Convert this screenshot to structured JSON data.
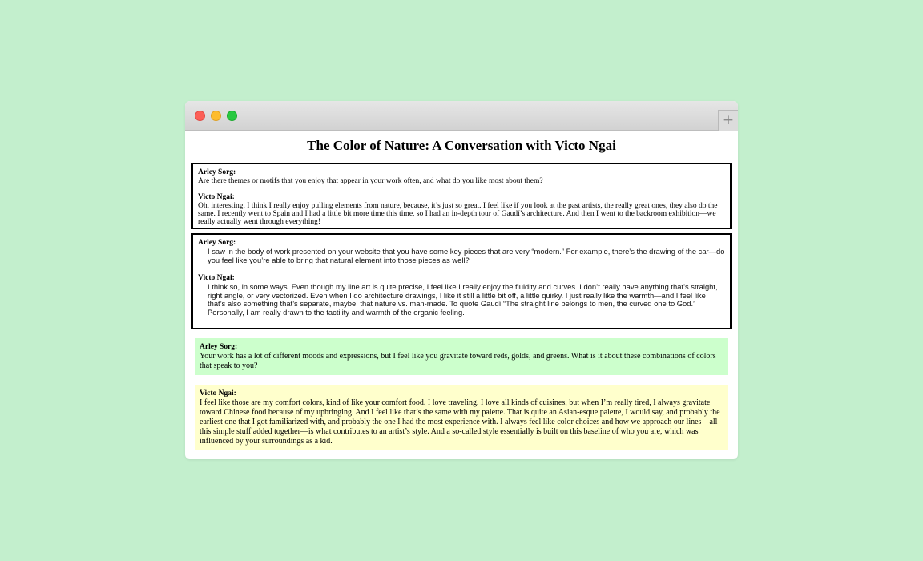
{
  "window": {
    "new_tab_label": "+"
  },
  "page": {
    "title": "The Color of Nature: A Conversation with Victo Ngai"
  },
  "box1": {
    "q_speaker": "Arley Sorg:",
    "q_text": "Are there themes or motifs that you enjoy that appear in your work often, and what do you like most about them?",
    "a_speaker": "Victo Ngai:",
    "a_text": "Oh, interesting. I think I really enjoy pulling elements from nature, because, it’s just so great. I feel like if you look at the past artists, the really great ones, they also do the same. I recently went to Spain and I had a little bit more time this time, so I had an in-depth tour of Gaudí’s architecture. And then I went to the backroom exhibition—we really actually went through everything!"
  },
  "box2": {
    "q_speaker": "Arley Sorg:",
    "q_text": "I saw in the body of work presented on your website that you have some key pieces that are very “modern.” For example, there’s the drawing of the car—do you feel like you’re able to bring that natural element into those pieces as well?",
    "a_speaker": "Victo Ngai:",
    "a_text": "I think so, in some ways. Even though my line art is quite precise, I feel like I really enjoy the fluidity and curves. I don’t really have anything that’s straight, right angle, or very vectorized. Even when I do architecture drawings, I like it still a little bit off, a little quirky. I just really like the warmth—and I feel like that’s also something that’s separate, maybe, that nature vs. man-made. To quote Gaudí “The straight line belongs to men, the curved one to God.” Personally, I am really drawn to the tactility and warmth of the organic feeling."
  },
  "panel_green": {
    "speaker": "Arley Sorg:",
    "text": "Your work has a lot of different moods and expressions, but I feel like you gravitate toward reds, golds, and greens. What is it about these combinations of colors that speak to you?"
  },
  "panel_yellow": {
    "speaker": "Victo Ngai:",
    "text": "I feel like those are my comfort colors, kind of like your comfort food. I love traveling, I love all kinds of cuisines, but when I’m really tired, I always gravitate toward Chinese food because of my upbringing. And I feel like that’s the same with my palette. That is quite an Asian-esque palette, I would say, and probably the earliest one that I got familiarized with, and probably the one I had the most experience with. I always feel like color choices and how we approach our lines—all this simple stuff added together—is what contributes to an artist’s style. And a so-called style essentially is built on this baseline of who you are, which was influenced by your surroundings as a kid."
  },
  "colors": {
    "background": "#c3efcd",
    "panel_green": "#ccffcc",
    "panel_yellow": "#ffffcc",
    "close": "#fc5f57",
    "minimize": "#fdbc2e",
    "maximize": "#28c840"
  }
}
